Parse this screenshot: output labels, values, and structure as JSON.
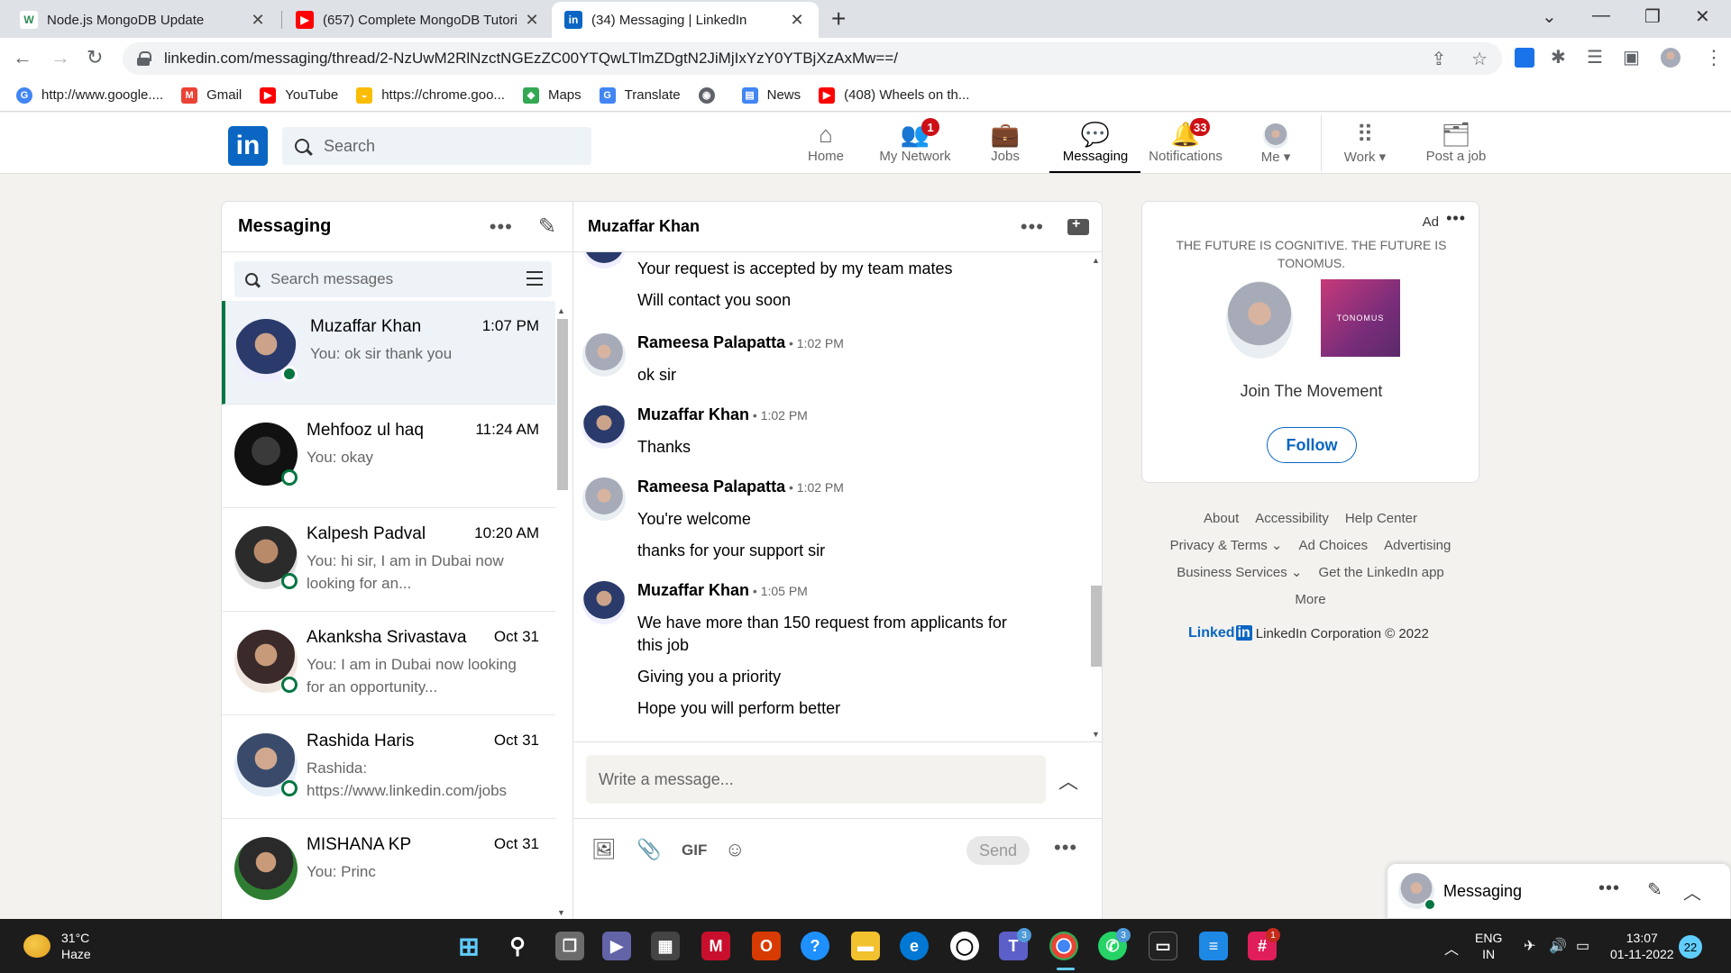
{
  "browser": {
    "tabs": [
      {
        "title": "Node.js MongoDB Update",
        "favicon": "W",
        "favicon_color": "#2e8b57"
      },
      {
        "title": "(657) Complete MongoDB Tutori",
        "favicon": "▶",
        "favicon_color": "#ff0000"
      },
      {
        "title": "(34) Messaging | LinkedIn",
        "favicon": "in",
        "favicon_color": "#0a66c2"
      }
    ],
    "url": "linkedin.com/messaging/thread/2-NzUwM2RlNzctNGEzZC00YTQwLTlmZDgtN2JiMjIxYzY0YTBjXzAxMw==/",
    "bookmarks": [
      {
        "label": "http://www.google....",
        "icon": "google-icon",
        "color": "#4285f4"
      },
      {
        "label": "Gmail",
        "icon": "gmail-icon",
        "color": "#ea4335"
      },
      {
        "label": "YouTube",
        "icon": "youtube-icon",
        "color": "#ff0000"
      },
      {
        "label": "https://chrome.goo...",
        "icon": "chrome-webstore-icon",
        "color": "#fbbc04"
      },
      {
        "label": "Maps",
        "icon": "maps-icon",
        "color": "#34a853"
      },
      {
        "label": "Translate",
        "icon": "translate-icon",
        "color": "#4285f4"
      },
      {
        "label": "",
        "icon": "globe-icon",
        "color": "#5f6368"
      },
      {
        "label": "News",
        "icon": "news-icon",
        "color": "#4285f4"
      },
      {
        "label": "(408) Wheels on th...",
        "icon": "youtube-icon",
        "color": "#ff0000"
      }
    ]
  },
  "linkedin": {
    "logo": "in",
    "search_placeholder": "Search",
    "nav": [
      {
        "label": "Home",
        "icon": "home-icon",
        "badge": ""
      },
      {
        "label": "My Network",
        "icon": "network-icon",
        "badge": "1"
      },
      {
        "label": "Jobs",
        "icon": "briefcase-icon",
        "badge": ""
      },
      {
        "label": "Messaging",
        "icon": "messaging-icon",
        "badge": ""
      },
      {
        "label": "Notifications",
        "icon": "bell-icon",
        "badge": "33"
      },
      {
        "label": "Me ▾",
        "icon": "avatar",
        "badge": ""
      },
      {
        "label": "Work ▾",
        "icon": "grid-icon",
        "badge": ""
      },
      {
        "label": "Post a job",
        "icon": "post-job-icon",
        "badge": ""
      }
    ]
  },
  "messaging": {
    "title": "Messaging",
    "search_placeholder": "Search messages",
    "conversations": [
      {
        "name": "Muzaffar Khan",
        "time": "1:07 PM",
        "snippet": "You: ok sir thank you",
        "active": true,
        "online": "filled"
      },
      {
        "name": "Mehfooz ul haq",
        "time": "11:24 AM",
        "snippet": "You: okay",
        "active": false,
        "online": "ring"
      },
      {
        "name": "Kalpesh Padval",
        "time": "10:20 AM",
        "snippet": "You: hi sir, I am in Dubai now looking for an...",
        "active": false,
        "online": "ring"
      },
      {
        "name": "Akanksha Srivastava",
        "time": "Oct 31",
        "snippet": "You: I am in Dubai now looking for an opportunity...",
        "active": false,
        "online": "ring"
      },
      {
        "name": "Rashida Haris",
        "time": "Oct 31",
        "snippet": "Rashida: https://www.linkedin.com/jobs",
        "active": false,
        "online": "ring"
      },
      {
        "name": "MISHANA KP",
        "time": "Oct 31",
        "snippet": "You: Princ",
        "active": false,
        "online": ""
      }
    ]
  },
  "thread": {
    "contact": "Muzaffar Khan",
    "lead_lines": [
      "Your request is accepted by my team mates",
      "Will contact you soon"
    ],
    "groups": [
      {
        "sender": "Rameesa Palapatta",
        "time": " • 1:02 PM",
        "lines": [
          "ok sir"
        ]
      },
      {
        "sender": "Muzaffar Khan",
        "time": " • 1:02 PM",
        "lines": [
          "Thanks"
        ]
      },
      {
        "sender": "Rameesa Palapatta",
        "time": " • 1:02 PM",
        "lines": [
          "You're welcome",
          "thanks for your support sir"
        ]
      },
      {
        "sender": "Muzaffar Khan",
        "time": " • 1:05 PM",
        "lines": [
          "We have more than 150 request from applicants for this job",
          "Giving you a priority",
          "Hope you will perform better"
        ]
      }
    ],
    "composer_placeholder": "Write a message...",
    "gif_label": "GIF",
    "send_label": "Send"
  },
  "ad": {
    "label": "Ad",
    "tagline": "THE FUTURE IS COGNITIVE. THE FUTURE IS TONOMUS.",
    "brand": "TONOMUS",
    "cta_text": "Join The Movement",
    "follow_label": "Follow"
  },
  "footer": {
    "rows": [
      [
        "About",
        "Accessibility",
        "Help Center"
      ],
      [
        "Privacy & Terms ⌄",
        "Ad Choices",
        "Advertising"
      ],
      [
        "Business Services ⌄",
        "Get the LinkedIn app"
      ],
      [
        "More"
      ]
    ],
    "logo_text": "Linked",
    "corp": "LinkedIn Corporation © 2022"
  },
  "overlay": {
    "title": "Messaging"
  },
  "taskbar": {
    "temp": "31°C",
    "condition": "Haze",
    "lang1": "ENG",
    "lang2": "IN",
    "time": "13:07",
    "date": "01-11-2022",
    "notif_count": "22"
  }
}
